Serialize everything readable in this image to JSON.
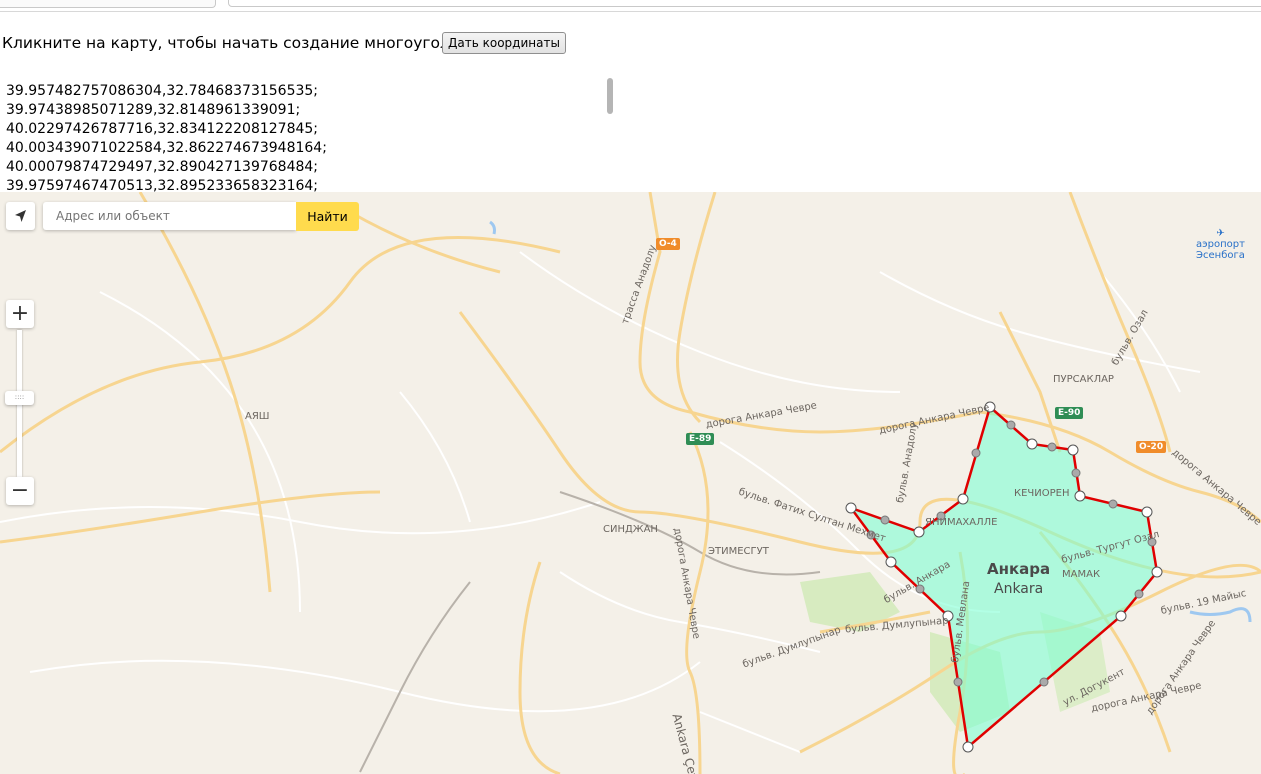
{
  "instruction": "Кликните на карту, чтобы начать создание многоугольника",
  "coords_button": "Дать координаты",
  "coordinates": [
    "39.957482757086304,32.78468373156535;",
    "39.97438985071289,32.8148961339091;",
    "40.02297426787716,32.834122208127845;",
    "40.003439071022584,32.862274673948164;",
    "40.00079874729497,32.890427139768484;",
    "39.97597467470513,32.895233658323164;"
  ],
  "search": {
    "placeholder": "Адрес или объект",
    "button": "Найти"
  },
  "zoom": {
    "in": "+",
    "out": "−",
    "thumb": "::::"
  },
  "icons": {
    "geolocation": "navigation-arrow-icon",
    "airport": "airplane-icon"
  },
  "colors": {
    "polygon_fill": "#7fffd4",
    "polygon_stroke": "#e00000",
    "search_button": "#ffdb4d",
    "river": "#9ec8f0",
    "park": "#cfe8b4"
  },
  "map_labels": {
    "city_ru": "Анкара",
    "city_en": "Ankara",
    "airport": [
      "аэропорт",
      "Эсенбога"
    ],
    "districts": [
      "АЯШ",
      "СИНДЖАН",
      "ЭТИМЕСГУТ",
      "КЕЧИОРЕН",
      "ПУРСАКЛАР",
      "МАМАК",
      "ЯНИМАХАЛЛЕ"
    ],
    "roads": [
      "трасса Анадолу",
      "дорога Анкара Чевре",
      "дорога Анкара Чевре",
      "бульв. Фатих Султан Мехмет",
      "бульв. Анадолу",
      "бульв. Анкара",
      "бульв. Думлупынар",
      "бульв. Думлупынар",
      "бульв. Мевлана",
      "бульв. Тургут Озал",
      "бульв. 19 Майыс",
      "ул. Догукент",
      "дорога Анкара Чевре",
      "бульв. Озал",
      "дорога Анкара Чевре",
      "дорога Анкара Чевре",
      "дорога Анкара Чевре",
      "Ankara Çevre"
    ],
    "shields": [
      "O-4",
      "E-89",
      "E-90",
      "O-20"
    ]
  }
}
